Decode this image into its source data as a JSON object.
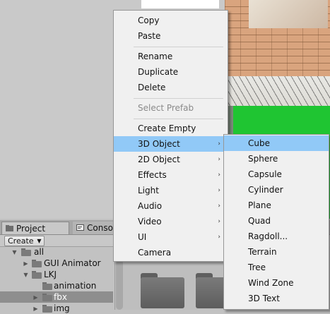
{
  "colors": {
    "menu_bg": "#f0f0f0",
    "highlight": "#91c9f7",
    "disabled_text": "#8a8a8a",
    "scene_green": "#1fc532",
    "brick": "#d9a47e",
    "panel_bg": "#c2c2c2"
  },
  "project_panel": {
    "tabs": [
      {
        "label": "Project",
        "icon": "project-icon"
      },
      {
        "label": "Conso",
        "icon": "console-icon"
      }
    ],
    "create_label": "Create",
    "tree": [
      {
        "label": "all",
        "icon": "folder-icon",
        "expanded": true
      },
      {
        "label": "GUI Animator",
        "icon": "folder-icon",
        "expanded": false
      },
      {
        "label": "LKJ",
        "icon": "folder-icon",
        "expanded": true
      },
      {
        "label": "animation",
        "icon": "folder-icon",
        "expanded": false
      },
      {
        "label": "fbx",
        "icon": "folder-icon",
        "expanded": false,
        "selected": true
      },
      {
        "label": "img",
        "icon": "folder-icon",
        "expanded": false
      }
    ]
  },
  "context_menu": {
    "items": [
      {
        "label": "Copy"
      },
      {
        "label": "Paste"
      },
      {
        "label": "Rename"
      },
      {
        "label": "Duplicate"
      },
      {
        "label": "Delete"
      },
      {
        "label": "Select Prefab",
        "disabled": true
      },
      {
        "label": "Create Empty"
      },
      {
        "label": "3D Object",
        "has_submenu": true,
        "highlighted": true
      },
      {
        "label": "2D Object",
        "has_submenu": true
      },
      {
        "label": "Effects",
        "has_submenu": true
      },
      {
        "label": "Light",
        "has_submenu": true
      },
      {
        "label": "Audio",
        "has_submenu": true
      },
      {
        "label": "Video",
        "has_submenu": true
      },
      {
        "label": "UI",
        "has_submenu": true
      },
      {
        "label": "Camera"
      }
    ],
    "submenu_arrow": "›"
  },
  "submenu_3d": {
    "items": [
      {
        "label": "Cube",
        "highlighted": true
      },
      {
        "label": "Sphere"
      },
      {
        "label": "Capsule"
      },
      {
        "label": "Cylinder"
      },
      {
        "label": "Plane"
      },
      {
        "label": "Quad"
      },
      {
        "label": "Ragdoll..."
      },
      {
        "label": "Terrain"
      },
      {
        "label": "Tree"
      },
      {
        "label": "Wind Zone"
      },
      {
        "label": "3D Text"
      }
    ]
  }
}
